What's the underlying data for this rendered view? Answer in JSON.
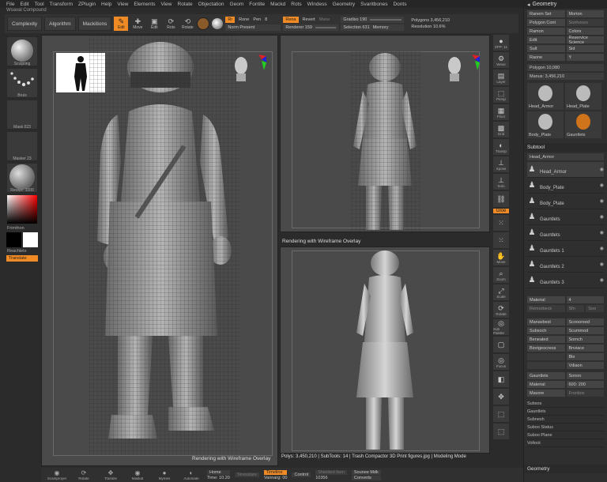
{
  "menu": [
    "File",
    "Edit",
    "Tool",
    "Transform",
    "ZPlugin",
    "Help",
    "View",
    "Elements",
    "View",
    "Rotate",
    "Objectation",
    "Geom",
    "Fontite",
    "Mackd",
    "Rots",
    "Windess",
    "Geometry",
    "Svaritbones",
    "Donts"
  ],
  "subtitle": "Wsaval Compound",
  "toolbar": {
    "complexity": "Complexity",
    "algorithm": "Algorithm",
    "mackitions": "Mackitions",
    "tools": [
      {
        "icon": "edit-icon",
        "glyph": "✎",
        "label": "Edit"
      },
      {
        "icon": "move-icon",
        "glyph": "✚",
        "label": "Move"
      },
      {
        "icon": "scale-icon",
        "glyph": "▣",
        "label": "Edit"
      },
      {
        "icon": "rotate-icon",
        "glyph": "⟳",
        "label": "Rots"
      },
      {
        "icon": "rotate2-icon",
        "glyph": "⟲",
        "label": "Rotate"
      }
    ],
    "rgb": "Rr",
    "rgb_val": "Rone",
    "pen": "Pen",
    "pen_val": "8",
    "rena_label": "Rena",
    "rena_active": "Rena",
    "revert": "Revert",
    "mane": "Mane",
    "norm_present": "Norm Present",
    "renderer": "Renderer 159",
    "gradient": "Gradiso 190",
    "selection": "Selection 631",
    "memory": "Memory",
    "polygons": "Polygons 3,456,210",
    "resolution": "Resolution 10.6%"
  },
  "left": {
    "brush_label": "Sculpting",
    "stroke_label": "Bruis",
    "alpha_label": "Mask 023",
    "texture_label": "Masker 23",
    "material_label": "Reolux: 1000",
    "gradient_label": "Frimthon",
    "swatch_label": "Reachlets",
    "tag": "Translate"
  },
  "viewports": {
    "top_right_label": "Rendering with Wireframe Overlay",
    "left_bottom_label": "Rendering with Wireframe Overlay",
    "status": "Polys: 3,450,210 | SubTools: 14 | Trash Compactor 3D Print figures.jpg | Modeling Mode"
  },
  "right_tools": [
    {
      "icon": "sphere-icon",
      "glyph": "●",
      "label": "ZPP: 11"
    },
    {
      "icon": "brush-icon",
      "glyph": "⚙",
      "label": "Wexe"
    },
    {
      "icon": "tool-icon",
      "glyph": "▤",
      "label": "Layer"
    },
    {
      "icon": "model-icon",
      "glyph": "⬚",
      "label": "Persp"
    },
    {
      "icon": "floor-icon",
      "glyph": "▦",
      "label": "Floor"
    },
    {
      "icon": "grid-icon",
      "glyph": "▩",
      "label": "Grid"
    },
    {
      "icon": "transp-icon",
      "glyph": "◐",
      "label": "Transp"
    },
    {
      "icon": "xpose-icon",
      "glyph": "⊥",
      "label": "Xpose"
    },
    {
      "icon": "solo-icon",
      "glyph": "⊥",
      "label": "Solo"
    },
    {
      "icon": "link-icon",
      "glyph": "⛓",
      "label": ""
    }
  ],
  "right_tools_2": [
    {
      "icon": "frame-icon",
      "glyph": "⁙",
      "label": ""
    },
    {
      "icon": "spotlight-icon",
      "glyph": "⁙",
      "label": ""
    },
    {
      "icon": "hand-icon",
      "glyph": "✋",
      "label": "Move"
    },
    {
      "icon": "zoom-icon",
      "glyph": "⌕",
      "label": "Zoom"
    },
    {
      "icon": "scale3d-icon",
      "glyph": "⤢",
      "label": "Scale"
    },
    {
      "icon": "rotate3d-icon",
      "glyph": "⟳",
      "label": "Rotate"
    },
    {
      "icon": "sub-icon",
      "glyph": "◎",
      "label": "Sub Palette"
    },
    {
      "icon": "poly-icon",
      "glyph": "▢",
      "label": ""
    },
    {
      "icon": "target-icon",
      "glyph": "◎",
      "label": "Focus"
    },
    {
      "icon": "solo2-icon",
      "glyph": "◧",
      "label": ""
    },
    {
      "icon": "cam-icon",
      "glyph": "✥",
      "label": ""
    },
    {
      "icon": "fill-icon",
      "glyph": "⬚",
      "label": ""
    },
    {
      "icon": "select-icon",
      "glyph": "⬚",
      "label": ""
    }
  ],
  "geo_tag": "Gloe",
  "panel": {
    "title": "Geometry",
    "buttons": [
      "Ranem Set",
      "Morton",
      "Polygon Cont",
      "Sonhoces",
      "Ramon",
      "Colors",
      "Edit",
      "Reservice Science",
      "Sult",
      "Sid",
      "Raone",
      "Y"
    ],
    "polygons": "Polygon 10,080",
    "manus": "Manus: 3,456,210",
    "tools": [
      {
        "name": "Head_Armor"
      },
      {
        "name": "Head_Plate"
      },
      {
        "name": "Body_Plate"
      },
      {
        "name": "Gauntlets"
      }
    ],
    "subtool_title": "Subtool",
    "subtool_field": "Head_Armor",
    "subtools": [
      "Head_Armor",
      "Body_Plate",
      "Body_Plate",
      "Gauntlets",
      "Gauntlets",
      "Gauntlets 1",
      "Gauntlets 2",
      "Gauntlets 3"
    ],
    "material": "Material",
    "material_val": "4",
    "remo": "Remorbeck",
    "remo_a": "Sfn",
    "remo_b": "Soo",
    "grid2": [
      "Manavbest",
      "Scoooreed",
      "Subsoch",
      "Scummod",
      "Beneated",
      "Sornch",
      "Biorigeocress",
      "Bnviace",
      "",
      "Ble",
      "",
      "Vdiaon"
    ],
    "gauntlets": "Gauntlets",
    "gauntlets_val": "Sonon",
    "material2": "Material",
    "material2_val": "600: 200",
    "mavore": "Mavore",
    "mavore_val": "Fronbox",
    "menu": [
      "Subsos",
      "Gauntlets",
      "Subnesh",
      "Suboo Status",
      "Suboo Plane",
      "Voltoot"
    ],
    "bottom_title": "Geometry"
  },
  "bottom": {
    "tools": [
      {
        "icon": "scamproper-icon",
        "glyph": "◉",
        "label": "Scamproyer"
      },
      {
        "icon": "rotate-bottom-icon",
        "glyph": "⟳",
        "label": "Rotate"
      },
      {
        "icon": "transit-icon",
        "glyph": "✥",
        "label": "Transite"
      },
      {
        "icon": "mask-icon",
        "glyph": "◉",
        "label": "Maskat"
      },
      {
        "icon": "mymes-icon",
        "glyph": "●",
        "label": "Mymes"
      },
      {
        "icon": "auto-icon",
        "glyph": "◐",
        "label": "Automate"
      }
    ],
    "home": "Home",
    "home_val": "Time: 10.20",
    "ghost": "Stresstare",
    "timeline": "Timeline",
    "timeline_val": "Vannarg: 00",
    "control": "Control",
    "control_val": "",
    "shielded": "Shielded Item",
    "shielded_val": "10356",
    "sounee": "Sounee Mdk",
    "sounee_val": "Converts"
  }
}
